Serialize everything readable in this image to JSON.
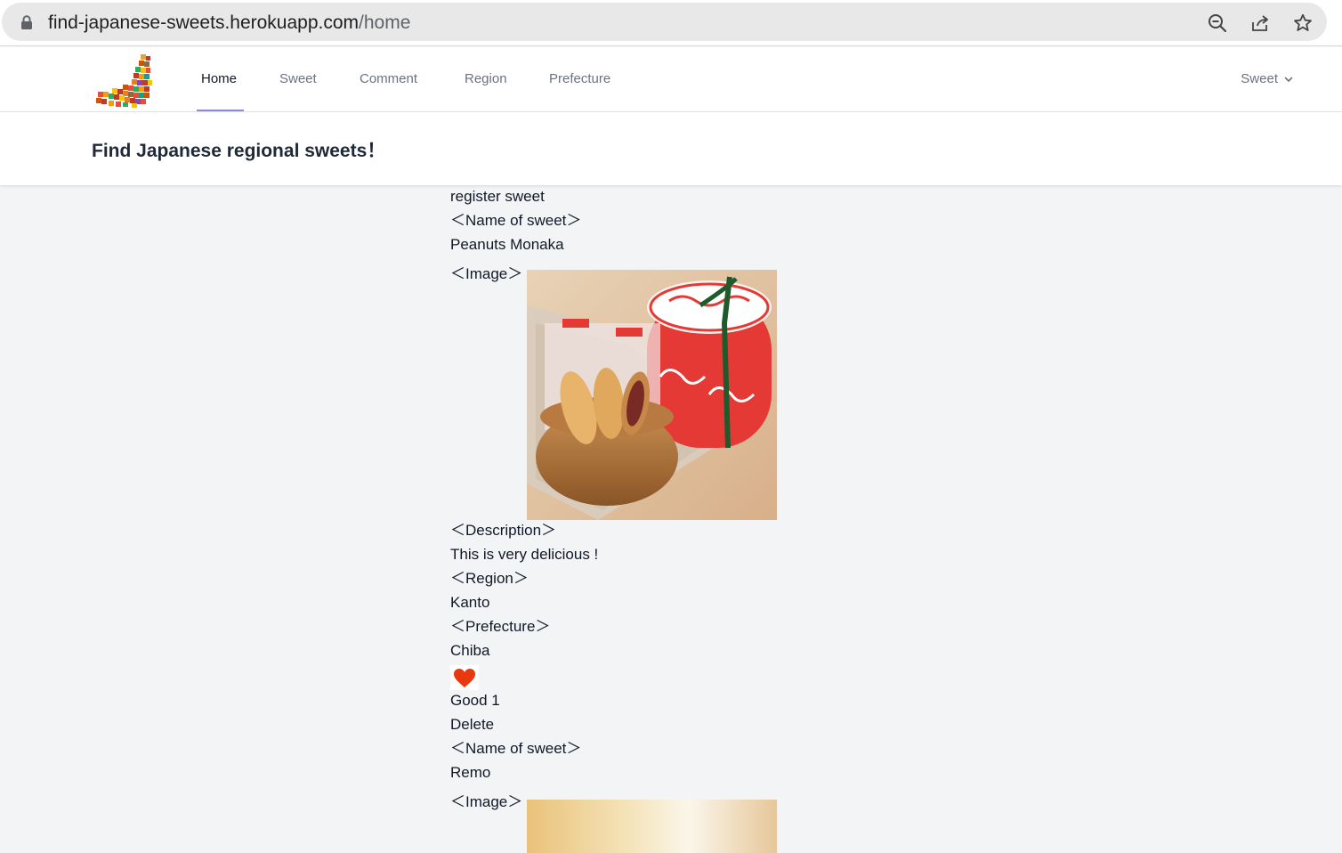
{
  "browser": {
    "url_domain": "find-japanese-sweets.herokuapp.com",
    "url_path": "/home"
  },
  "nav": {
    "links": [
      {
        "label": "Home",
        "active": true
      },
      {
        "label": "Sweet",
        "active": false
      },
      {
        "label": "Comment",
        "active": false
      },
      {
        "label": "Region",
        "active": false
      },
      {
        "label": "Prefecture",
        "active": false
      }
    ],
    "user_menu_label": "Sweet"
  },
  "header": {
    "title": "Find Japanese regional sweets！"
  },
  "content": {
    "register_link": "register sweet",
    "sweets": [
      {
        "name_label": "＜Name of sweet＞",
        "name": "Peanuts Monaka",
        "image_label": "＜Image＞",
        "description_label": "＜Description＞",
        "description": "This is very delicious !",
        "region_label": "＜Region＞",
        "region": "Kanto",
        "prefecture_label": "＜Prefecture＞",
        "prefecture": "Chiba",
        "good_label": "Good 1",
        "delete_label": "Delete"
      },
      {
        "name_label": "＜Name of sweet＞",
        "name": "Remo",
        "image_label": "＜Image＞"
      }
    ]
  },
  "colors": {
    "accent": "#818cf8",
    "heart": "#e8380d",
    "background": "#f3f4f6"
  }
}
